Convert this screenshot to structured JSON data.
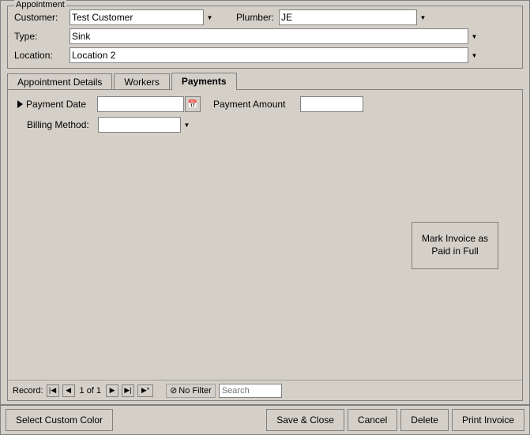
{
  "window": {
    "title": "Appointment"
  },
  "appointment": {
    "customer_label": "Customer:",
    "customer_value": "Test Customer",
    "plumber_label": "Plumber:",
    "plumber_value": "JE",
    "type_label": "Type:",
    "type_value": "Sink",
    "location_label": "Location:",
    "location_value": "Location 2"
  },
  "tabs": {
    "items": [
      {
        "id": "appointment-details",
        "label": "Appointment Details"
      },
      {
        "id": "workers",
        "label": "Workers"
      },
      {
        "id": "payments",
        "label": "Payments"
      }
    ],
    "active": "payments"
  },
  "payments": {
    "date_label": "Payment Date",
    "date_value": "",
    "amount_label": "Payment Amount",
    "amount_value": "",
    "billing_label": "Billing Method:",
    "billing_value": "",
    "mark_paid_label": "Mark Invoice as Paid in Full"
  },
  "record_nav": {
    "record_label": "Record:",
    "record_info": "1 of 1",
    "filter_label": "No Filter",
    "search_placeholder": "Search"
  },
  "bottom_bar": {
    "select_custom_color": "Select Custom Color",
    "save_close": "Save & Close",
    "cancel": "Cancel",
    "delete": "Delete",
    "print_invoice": "Print Invoice"
  }
}
